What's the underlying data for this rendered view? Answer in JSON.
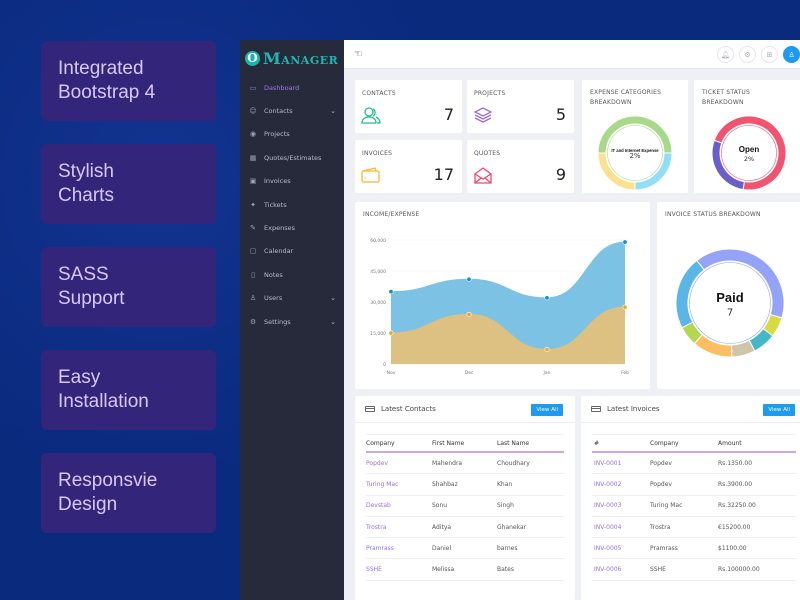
{
  "features": [
    "Integrated\nBootstrap 4",
    "Stylish\nCharts",
    "SASS\nSupport",
    "Easy\nInstallation",
    "Responsvie\nDesign"
  ],
  "app": {
    "logo_letter": "O",
    "logo_text": "Manager"
  },
  "sidebar": {
    "items": [
      {
        "label": "Dashboard",
        "icon": "monitor-icon",
        "glyph": "▭",
        "active": true,
        "chevron": false
      },
      {
        "label": "Contacts",
        "icon": "smiley-icon",
        "glyph": "☺",
        "chevron": true
      },
      {
        "label": "Projects",
        "icon": "database-icon",
        "glyph": "◉",
        "chevron": false
      },
      {
        "label": "Quotes/Estimates",
        "icon": "grid-icon",
        "glyph": "▦",
        "chevron": false
      },
      {
        "label": "Invoices",
        "icon": "invoice-icon",
        "glyph": "▣",
        "chevron": false
      },
      {
        "label": "Tickets",
        "icon": "ticket-icon",
        "glyph": "✦",
        "chevron": false
      },
      {
        "label": "Expenses",
        "icon": "pencil-icon",
        "glyph": "✎",
        "chevron": false
      },
      {
        "label": "Calendar",
        "icon": "calendar-icon",
        "glyph": "▢",
        "chevron": false
      },
      {
        "label": "Notes",
        "icon": "notes-icon",
        "glyph": "▯",
        "chevron": false
      },
      {
        "label": "Users",
        "icon": "users-icon",
        "glyph": "♙",
        "chevron": true
      },
      {
        "label": "Settings",
        "icon": "gear-icon",
        "glyph": "⚙",
        "chevron": true
      }
    ],
    "chevron_glyph": "⌄"
  },
  "topbar": {
    "toggle_glyph": "☜",
    "icons": [
      {
        "name": "bell-icon",
        "glyph": "♫"
      },
      {
        "name": "gear-icon",
        "glyph": "⚙"
      },
      {
        "name": "apps-icon",
        "glyph": "⊞"
      },
      {
        "name": "user-icon",
        "glyph": "♙"
      }
    ]
  },
  "stats": [
    {
      "label": "CONTACTS",
      "value": "7",
      "color": "#1fbf8f"
    },
    {
      "label": "PROJECTS",
      "value": "5",
      "color": "#9b6de0"
    },
    {
      "label": "INVOICES",
      "value": "17",
      "color": "#f7b731"
    },
    {
      "label": "QUOTES",
      "value": "9",
      "color": "#ef476f"
    }
  ],
  "expense_donut": {
    "title": "EXPENSE CATEGORIES\nBREAKDOWN",
    "center_label": "IT and Internet Expense",
    "center_value": "2%",
    "segments": [
      {
        "value": 50,
        "color": "#a8d88a"
      },
      {
        "value": 25,
        "color": "#92ddf8"
      },
      {
        "value": 25,
        "color": "#fbe08f"
      }
    ]
  },
  "ticket_donut": {
    "title": "TICKET STATUS\nBREAKDOWN",
    "center_label": "Open",
    "center_value": "2%",
    "segments": [
      {
        "value": 72,
        "color": "#f2536e"
      },
      {
        "value": 28,
        "color": "#6a5fc9"
      }
    ]
  },
  "invoice_donut": {
    "title": "INVOICE STATUS BREAKDOWN",
    "center_label": "Paid",
    "center_value": "7",
    "segments": [
      {
        "value": 40,
        "color": "#94a3f8"
      },
      {
        "value": 6,
        "color": "#d8da41"
      },
      {
        "value": 7,
        "color": "#45b7c9"
      },
      {
        "value": 7,
        "color": "#cfc6a8"
      },
      {
        "value": 12,
        "color": "#fbbf63"
      },
      {
        "value": 6,
        "color": "#b1d84f"
      },
      {
        "value": 22,
        "color": "#5bb5e6"
      }
    ]
  },
  "chart_data": {
    "type": "area",
    "title": "INCOME/EXPENSE",
    "xlabel": "",
    "ylabel": "",
    "categories": [
      "Nov",
      "Dec",
      "Jan",
      "Feb"
    ],
    "ylim": [
      0,
      60000
    ],
    "yticks": [
      "0",
      "15,000",
      "30,000",
      "45,000",
      "60,000"
    ],
    "series": [
      {
        "name": "Income",
        "values": [
          35000,
          41000,
          32000,
          59000
        ],
        "color": "#0f8fd8",
        "fill": "#7cc2e4"
      },
      {
        "name": "Expense",
        "values": [
          15000,
          24000,
          7000,
          27500
        ],
        "color": "#f5a623",
        "fill": "#dcc182"
      }
    ],
    "grid": true,
    "legend": "none"
  },
  "contacts": {
    "title": "Latest Contacts",
    "view_all": "View All",
    "headers": [
      "Company",
      "First Name",
      "Last Name"
    ],
    "rows": [
      [
        "Popdev",
        "Mahendra",
        "Choudhary"
      ],
      [
        "Turing Mac",
        "Shahbaz",
        "Khan"
      ],
      [
        "Devstab",
        "Sonu",
        "Singh"
      ],
      [
        "Trostra",
        "Aditya",
        "Ghanekar"
      ],
      [
        "Pramrass",
        "Daniel",
        "barnes"
      ],
      [
        "SSHE",
        "Melissa",
        "Bates"
      ]
    ]
  },
  "invoices": {
    "title": "Latest Invoices",
    "view_all": "View All",
    "headers": [
      "#",
      "Company",
      "Amount"
    ],
    "rows": [
      [
        "INV-0001",
        "Popdev",
        "Rs.1350.00"
      ],
      [
        "INV-0002",
        "Popdev",
        "Rs.3900.00"
      ],
      [
        "INV-0003",
        "Turing Mac",
        "Rs.32250.00"
      ],
      [
        "INV-0004",
        "Trostra",
        "€15200.00"
      ],
      [
        "INV-0005",
        "Pramrass",
        "$1100.00"
      ],
      [
        "INV-0006",
        "SSHE",
        "Rs.100000.00"
      ]
    ]
  }
}
